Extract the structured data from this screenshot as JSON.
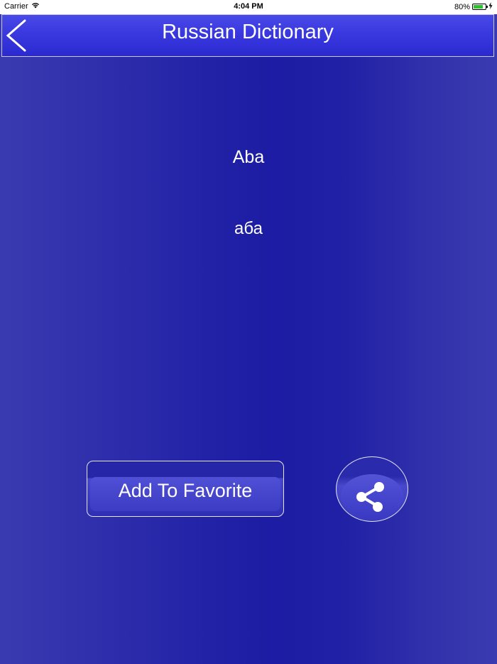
{
  "status_bar": {
    "carrier": "Carrier",
    "time": "4:04 PM",
    "battery_text": "80%",
    "battery_level": 0.8
  },
  "nav": {
    "title": "Russian Dictionary",
    "back_icon": "chevron-left-icon"
  },
  "entry": {
    "word": "Aba",
    "translation": "аба"
  },
  "actions": {
    "favorite_label": "Add To Favorite",
    "share_icon": "share-icon"
  },
  "colors": {
    "background": "#2424a8",
    "nav_bar": "#3a3ae0",
    "text": "#ffffff"
  }
}
